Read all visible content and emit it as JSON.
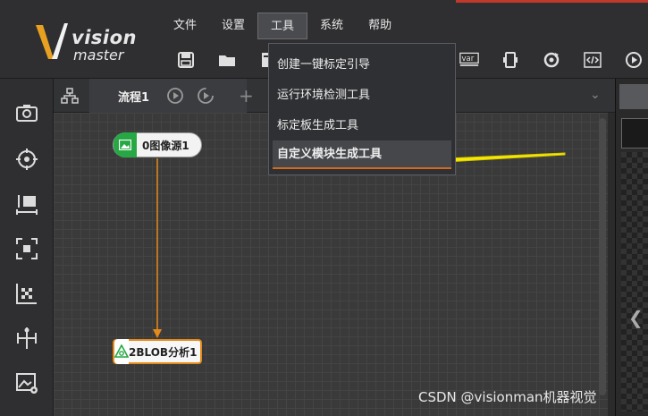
{
  "app": {
    "logo_line1": "vision",
    "logo_line2": "master"
  },
  "menubar": {
    "items": [
      "文件",
      "设置",
      "工具",
      "系统",
      "帮助"
    ],
    "active": "工具"
  },
  "toolbar": {
    "left": [
      "save-icon",
      "open-folder-icon",
      "document-icon"
    ],
    "right": [
      "var-icon",
      "device-icon",
      "refresh-target-icon",
      "code-icon",
      "play-icon"
    ],
    "var_label": "var"
  },
  "leftbar": {
    "items": [
      "camera-icon",
      "target-icon",
      "measure-icon",
      "roi-icon",
      "calibration-icon",
      "split-icon",
      "image-settings-icon"
    ]
  },
  "tabstrip": {
    "flow_name": "流程1",
    "add": "+",
    "collapse": "⌄"
  },
  "dropdown": {
    "items": [
      "创建一键标定引导",
      "运行环境检测工具",
      "标定板生成工具",
      "自定义模块生成工具"
    ],
    "highlighted_index": 3
  },
  "nodes": {
    "source": {
      "label": "0图像源1"
    },
    "blob": {
      "label": "2BLOB分析1"
    }
  },
  "colors": {
    "accent_orange": "#e48a1a",
    "source_green": "#27a844",
    "arrow_yellow": "#f5e600"
  },
  "watermark": "CSDN @visionman机器视觉"
}
